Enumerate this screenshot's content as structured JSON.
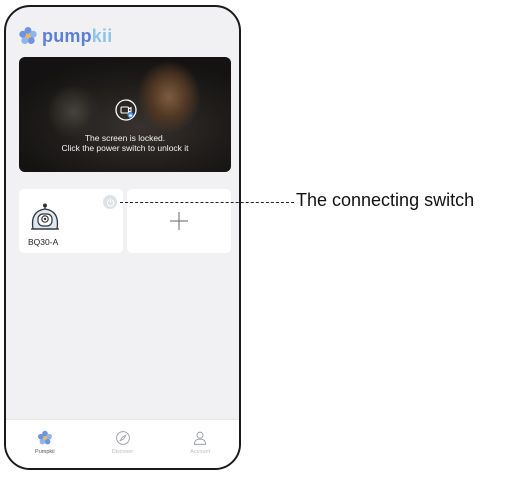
{
  "brand": {
    "name_main": "pump",
    "name_accent": "kii",
    "logo_icon": "flower-logo-icon"
  },
  "camera": {
    "locked_line1": "The screen is locked.",
    "locked_line2": "Click the power switch to unlock it",
    "lock_icon": "camera-lock-icon"
  },
  "devices": [
    {
      "label": "BQ30-A",
      "icon": "baby-monitor-icon",
      "power_icon": "power-icon"
    }
  ],
  "add_tile": {
    "icon": "plus-icon"
  },
  "nav": [
    {
      "label": "Pumpkii",
      "icon": "flower-icon",
      "active": true
    },
    {
      "label": "Discover",
      "icon": "compass-icon",
      "active": false
    },
    {
      "label": "Account",
      "icon": "person-icon",
      "active": false
    }
  ],
  "annotation": {
    "text": "The connecting switch"
  },
  "colors": {
    "brand": "#5b7fd6",
    "brand_light": "#8fc3e8",
    "background": "#f1f1f4"
  }
}
